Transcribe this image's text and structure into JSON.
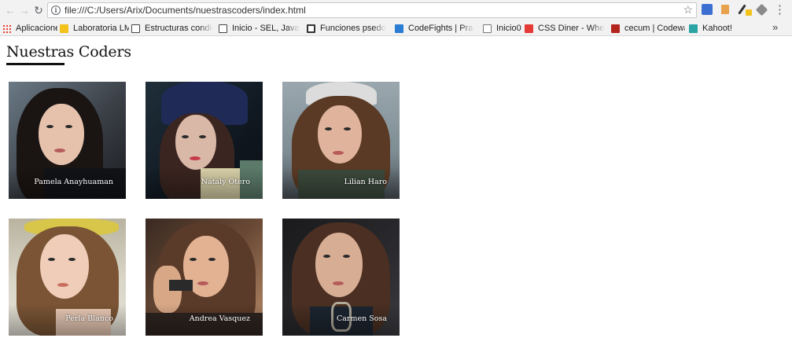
{
  "browser": {
    "url": "file:///C:/Users/Arix/Documents/nuestrascoders/index.html",
    "nav_icons": [
      "back-arrow-icon",
      "forward-arrow-icon",
      "reload-icon"
    ],
    "bookmarks": [
      {
        "label": "Aplicaciones",
        "icon": "apps-grid-icon"
      },
      {
        "label": "Laboratoria LMS",
        "icon": "laboratoria-icon"
      },
      {
        "label": "Estructuras condicion",
        "icon": "book-icon"
      },
      {
        "label": "Inicio - SEL, JavaScrip",
        "icon": "book-icon"
      },
      {
        "label": "Funciones psedocód",
        "icon": "circle-logo-icon"
      },
      {
        "label": "CodeFights | Practice",
        "icon": "codefights-icon"
      },
      {
        "label": "Inicio0",
        "icon": "page-icon"
      },
      {
        "label": "CSS Diner - Where w",
        "icon": "red-dot-icon"
      },
      {
        "label": "cecum | Codewars",
        "icon": "codewars-icon"
      },
      {
        "label": "Kahoot!",
        "icon": "kahoot-icon"
      }
    ],
    "more_label": "»"
  },
  "page": {
    "title": "Nuestras Coders",
    "coders": [
      {
        "name": "Pamela Anayhuaman"
      },
      {
        "name": "Nataly Otero"
      },
      {
        "name": "Lilian Haro"
      },
      {
        "name": "Perla Blanco"
      },
      {
        "name": "Andrea Vasquez"
      },
      {
        "name": "Carmen Sosa"
      }
    ]
  },
  "colors": {
    "chrome_bg": "#f2f2f2",
    "page_bg": "#ffffff",
    "title_text": "#111111",
    "name_text": "#ffffff"
  }
}
